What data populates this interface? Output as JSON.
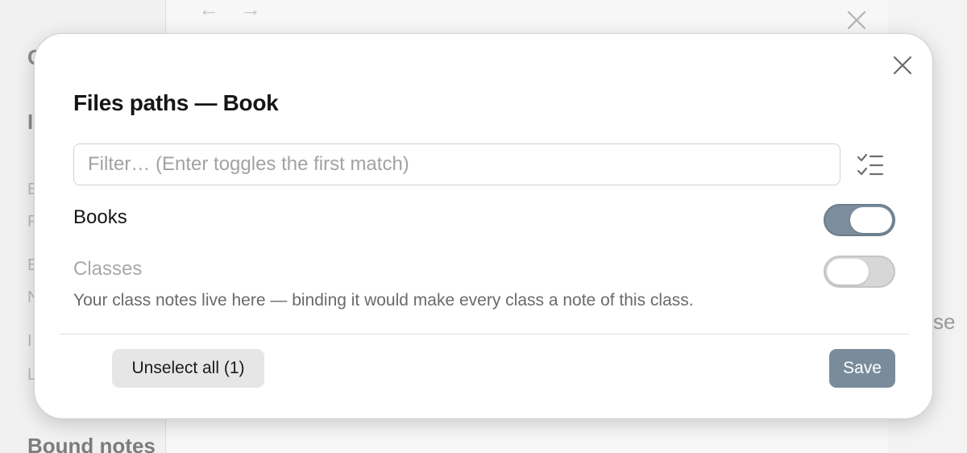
{
  "background": {
    "nav_back_glyph": "←",
    "nav_forward_glyph": "→",
    "left_letters": [
      "C",
      "I",
      "E",
      "P",
      "E",
      "N",
      "I",
      "L"
    ],
    "side_text": "se",
    "bottom_heading": "Bound notes"
  },
  "modal": {
    "title": "Files paths — Book",
    "filter_placeholder": "Filter… (Enter toggles the first match)",
    "filter_value": "",
    "rows": [
      {
        "label": "Books",
        "enabled": true,
        "description": ""
      },
      {
        "label": "Classes",
        "enabled": false,
        "description": "Your class notes live here — binding it would make every class a note of this class."
      }
    ],
    "unselect_all_label": "Unselect all (1)",
    "save_label": "Save"
  },
  "icons": {
    "close": "close-icon",
    "toggle_all": "checklist-icon",
    "nav_back": "arrow-left-icon",
    "nav_forward": "arrow-right-icon"
  },
  "colors": {
    "accent": "#7a8c9b",
    "toggle_on": "#7c8e9d",
    "toggle_off": "#d7d7d7",
    "button_secondary": "#e6e6e6",
    "disabled_text": "#a8a8a8"
  }
}
